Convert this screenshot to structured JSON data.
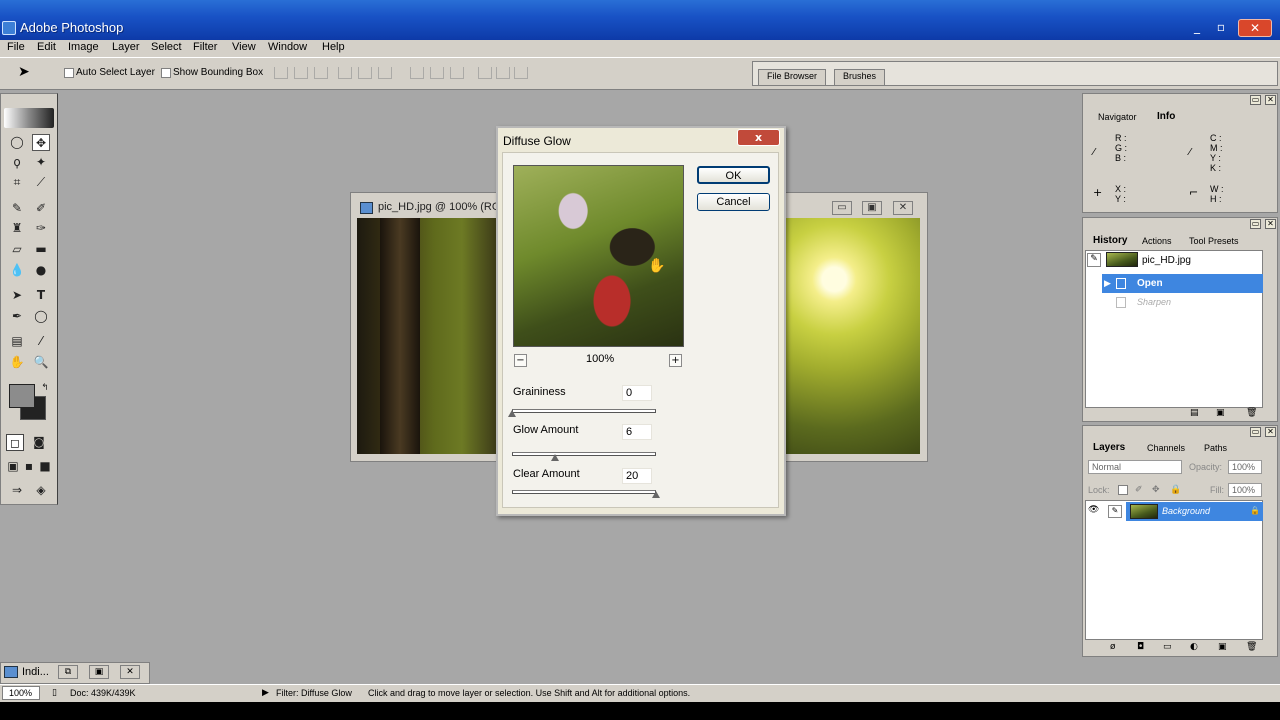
{
  "app": {
    "title": "Adobe Photoshop",
    "window_buttons": [
      "_",
      "▫",
      "✕"
    ]
  },
  "menu": [
    "File",
    "Edit",
    "Image",
    "Layer",
    "Select",
    "Filter",
    "View",
    "Window",
    "Help"
  ],
  "options": {
    "auto_select_label": "Auto Select Layer",
    "bounding_box_label": "Show Bounding Box",
    "well_tabs": [
      "File Browser",
      "Brushes"
    ]
  },
  "document": {
    "title": "pic_HD.jpg @ 100% (RGB/8)"
  },
  "dialog": {
    "title": "Diffuse Glow",
    "close": "x",
    "zoom": "100%",
    "ok": "OK",
    "cancel": "Cancel",
    "params": [
      {
        "label": "Graininess",
        "value": "0",
        "slider_fraction": 0.0
      },
      {
        "label": "Glow Amount",
        "value": "6",
        "slider_fraction": 0.3
      },
      {
        "label": "Clear Amount",
        "value": "20",
        "slider_fraction": 1.0
      }
    ]
  },
  "info": {
    "tabs": [
      "Navigator",
      "Info"
    ],
    "rgb": [
      "R :",
      "G :",
      "B :"
    ],
    "cmyk": [
      "C :",
      "M :",
      "Y :",
      "K :"
    ],
    "xy": [
      "X :",
      "Y :"
    ],
    "wh": [
      "W :",
      "H :"
    ]
  },
  "history": {
    "tabs": [
      "History",
      "Actions",
      "Tool Presets"
    ],
    "snapshot": "pic_HD.jpg",
    "items": [
      "Open",
      "Sharpen"
    ]
  },
  "layers": {
    "tabs": [
      "Layers",
      "Channels",
      "Paths"
    ],
    "blend": "Normal",
    "opacity_label": "Opacity:",
    "opacity": "100%",
    "lock_label": "Lock:",
    "fill_label": "Fill:",
    "fill": "100%",
    "layer_name": "Background"
  },
  "minimized": {
    "title": "Indi..."
  },
  "status": {
    "zoom": "100%",
    "doc": "Doc: 439K/439K",
    "filter": "Filter: Diffuse Glow",
    "hint": "Click and drag to move layer or selection.  Use Shift and Alt for additional options."
  },
  "colors": {
    "titlebar": "#1953c6",
    "chrome": "#d4d0c8",
    "workspace": "#a7a7a7",
    "selection": "#3e86e0"
  }
}
